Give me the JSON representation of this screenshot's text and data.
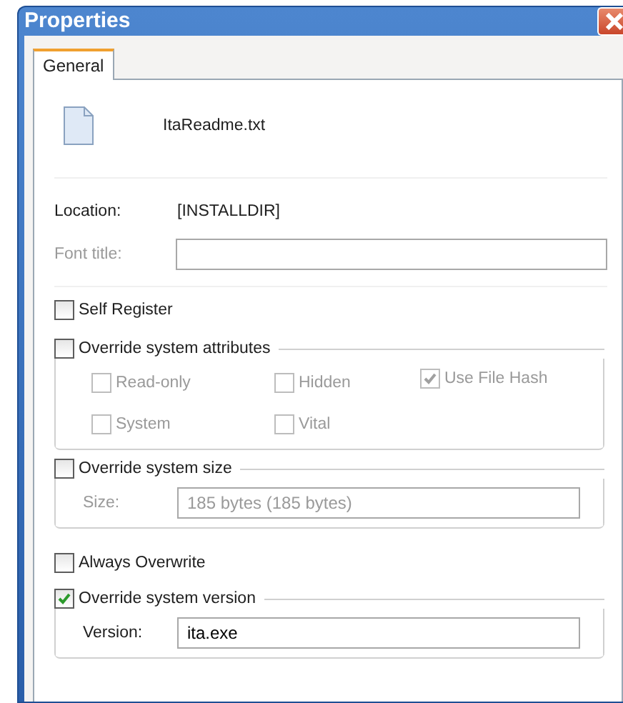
{
  "window": {
    "title": "Properties"
  },
  "tabs": [
    {
      "label": "General",
      "selected": true
    }
  ],
  "file": {
    "name": "ItaReadme.txt"
  },
  "location": {
    "label": "Location:",
    "value": "[INSTALLDIR]"
  },
  "font_title": {
    "label": "Font title:",
    "disabled": true
  },
  "self_register": {
    "label": "Self Register",
    "checked": false,
    "disabled": false
  },
  "attributes_group": {
    "label": "Override system attributes",
    "checked": false,
    "disabled": false,
    "options": [
      {
        "label": "Read-only",
        "checked": false,
        "disabled": true
      },
      {
        "label": "Hidden",
        "checked": false,
        "disabled": true
      },
      {
        "label": "Use File Hash",
        "checked": true,
        "disabled": true
      },
      {
        "label": "System",
        "checked": false,
        "disabled": true
      },
      {
        "label": "Vital",
        "checked": false,
        "disabled": true
      }
    ]
  },
  "size_group": {
    "label": "Override system size",
    "checked": false,
    "disabled": false,
    "field_label": "Size:",
    "field_value": "185 bytes (185 bytes)",
    "field_disabled": true
  },
  "always_overwrite": {
    "label": "Always Overwrite",
    "checked": false,
    "disabled": false
  },
  "version_group": {
    "label": "Override system version",
    "checked": true,
    "disabled": false,
    "field_label": "Version:",
    "field_value": "ita.exe",
    "field_disabled": false
  }
}
